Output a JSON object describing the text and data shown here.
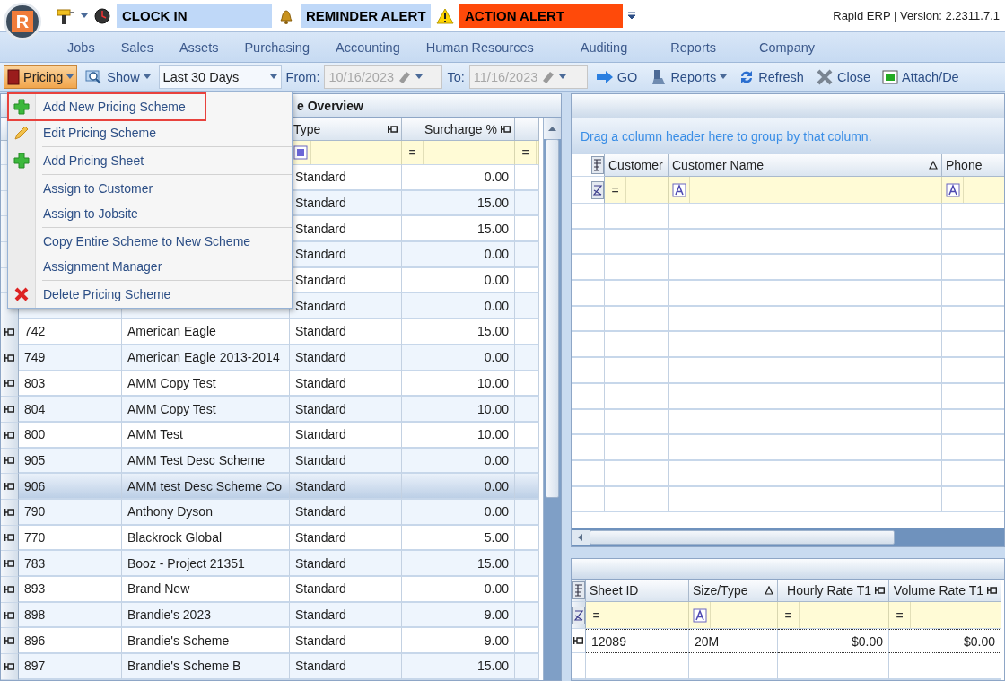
{
  "titlebar": {
    "logo": "R",
    "clock": "CLOCK IN",
    "reminder": "REMINDER ALERT",
    "action": "ACTION ALERT",
    "version": "Rapid ERP | Version: 2.2311.7.1"
  },
  "nav": [
    "Jobs",
    "Sales",
    "Assets",
    "Purchasing",
    "Accounting",
    "Human Resources",
    "Auditing",
    "Reports",
    "Company"
  ],
  "toolbar": {
    "pricing": {
      "label": "Pricing",
      "open": true
    },
    "show": "Show",
    "range": "Last 30 Days",
    "from_label": "From:",
    "from": {
      "value": "10/16/2023",
      "disabled": true
    },
    "to_label": "To:",
    "to": {
      "value": "11/16/2023",
      "disabled": true
    },
    "go": "GO",
    "reports": "Reports",
    "refresh": "Refresh",
    "close": "Close",
    "attach": "Attach/De"
  },
  "pricing_menu": [
    [
      {
        "label": "Add New Pricing Scheme",
        "kind": "add",
        "selected": true
      },
      {
        "label": "Edit Pricing Scheme",
        "kind": "edit",
        "selected": false
      }
    ],
    [
      {
        "label": "Add Pricing Sheet",
        "kind": "add",
        "selected": false
      }
    ],
    [
      {
        "label": "Assign to Customer",
        "kind": "plain",
        "selected": false
      },
      {
        "label": "Assign to Jobsite",
        "kind": "plain",
        "selected": false
      }
    ],
    [
      {
        "label": "Copy Entire Scheme to New Scheme",
        "kind": "plain",
        "selected": false
      },
      {
        "label": "Assignment Manager",
        "kind": "plain",
        "selected": false
      }
    ],
    [
      {
        "label": "Delete Pricing Scheme",
        "kind": "delete",
        "selected": false
      }
    ]
  ],
  "schemes": {
    "title": "e Overview",
    "columns": [
      "Type",
      "Surcharge %"
    ],
    "filters": [
      {
        "kind": "check"
      },
      {
        "kind": "equals",
        "text": "="
      },
      {
        "kind": "equals",
        "text": "="
      }
    ],
    "rows": [
      {
        "type": "Standard",
        "surcharge": "0.00",
        "selected": false
      },
      {
        "type": "Standard",
        "surcharge": "15.00",
        "selected": false
      },
      {
        "type": "Standard",
        "surcharge": "15.00",
        "selected": false
      },
      {
        "type": "Standard",
        "surcharge": "0.00",
        "selected": false
      },
      {
        "type": "Standard",
        "surcharge": "0.00",
        "selected": false
      },
      {
        "type": "Standard",
        "surcharge": "0.00",
        "selected": false
      },
      {
        "id": "742",
        "name": "American Eagle",
        "type": "Standard",
        "surcharge": "15.00",
        "selected": false
      },
      {
        "id": "749",
        "name": "American Eagle 2013-2014",
        "type": "Standard",
        "surcharge": "0.00",
        "selected": false
      },
      {
        "id": "803",
        "name": "AMM Copy Test",
        "type": "Standard",
        "surcharge": "10.00",
        "selected": false
      },
      {
        "id": "804",
        "name": "AMM Copy Test",
        "type": "Standard",
        "surcharge": "10.00",
        "selected": false
      },
      {
        "id": "800",
        "name": "AMM Test",
        "type": "Standard",
        "surcharge": "10.00",
        "selected": false
      },
      {
        "id": "905",
        "name": "AMM Test Desc Scheme",
        "type": "Standard",
        "surcharge": "0.00",
        "selected": false
      },
      {
        "id": "906",
        "name": "AMM test Desc Scheme Co",
        "type": "Standard",
        "surcharge": "0.00",
        "selected": true
      },
      {
        "id": "790",
        "name": "Anthony Dyson",
        "type": "Standard",
        "surcharge": "0.00",
        "selected": false
      },
      {
        "id": "770",
        "name": "Blackrock Global",
        "type": "Standard",
        "surcharge": "5.00",
        "selected": false
      },
      {
        "id": "783",
        "name": "Booz - Project 21351",
        "type": "Standard",
        "surcharge": "15.00",
        "selected": false
      },
      {
        "id": "893",
        "name": "Brand New",
        "type": "Standard",
        "surcharge": "0.00",
        "selected": false
      },
      {
        "id": "898",
        "name": "Brandie's 2023",
        "type": "Standard",
        "surcharge": "9.00",
        "selected": false
      },
      {
        "id": "896",
        "name": "Brandie's Scheme",
        "type": "Standard",
        "surcharge": "9.00",
        "selected": false
      },
      {
        "id": "897",
        "name": "Brandie's Scheme B",
        "type": "Standard",
        "surcharge": "15.00",
        "selected": false
      }
    ]
  },
  "customers": {
    "group_hint": "Drag a column header here to group by that column.",
    "columns": [
      {
        "label": "Customer",
        "kind": "plain"
      },
      {
        "label": "Customer Name",
        "kind": "sorted"
      },
      {
        "label": "Phone",
        "kind": "plain"
      }
    ],
    "filters": [
      {
        "kind": "equals",
        "text": "="
      },
      {
        "kind": "text"
      },
      {
        "kind": "text"
      }
    ]
  },
  "sheets": {
    "columns": [
      {
        "label": "Sheet ID",
        "sorted": false
      },
      {
        "label": "Size/Type",
        "sorted": true
      },
      {
        "label": "Hourly Rate T1",
        "sorted": false
      },
      {
        "label": "Volume Rate T1",
        "sorted": false
      }
    ],
    "filters": [
      {
        "kind": "equals",
        "text": "="
      },
      {
        "kind": "text"
      },
      {
        "kind": "equals",
        "text": "="
      },
      {
        "kind": "equals",
        "text": "="
      }
    ],
    "rows": [
      {
        "cells": [
          "12089",
          "20M",
          "$0.00",
          "$0.00"
        ],
        "selected": true
      }
    ]
  }
}
